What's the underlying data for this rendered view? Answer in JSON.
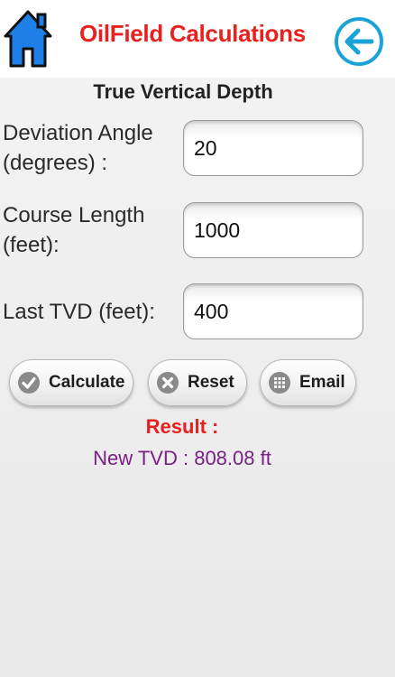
{
  "header": {
    "title": "OilField Calculations",
    "home_icon": "home-icon",
    "back_icon": "back-arrow-icon",
    "title_color": "#e8201e",
    "home_color": "#1e7fe8",
    "back_color": "#1aa3d6"
  },
  "page": {
    "title": "True Vertical Depth"
  },
  "fields": [
    {
      "label_line1": "Deviation Angle",
      "label_line2": "(degrees) :",
      "value": "20"
    },
    {
      "label_line1": "Course Length",
      "label_line2": "(feet):",
      "value": "1000"
    },
    {
      "label": "Last TVD (feet):",
      "value": "400"
    }
  ],
  "buttons": {
    "calculate": {
      "label": "Calculate",
      "icon": "check-icon"
    },
    "reset": {
      "label": "Reset",
      "icon": "cancel-icon"
    },
    "email": {
      "label": "Email",
      "icon": "grid-icon"
    }
  },
  "result": {
    "heading": "Result :",
    "value": "New TVD : 808.08 ft",
    "heading_color": "#e8201e",
    "value_color": "#7a1f86"
  }
}
